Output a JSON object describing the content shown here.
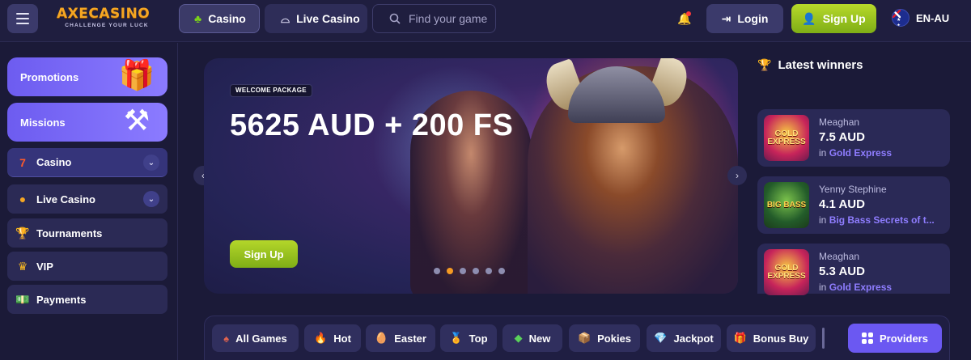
{
  "header": {
    "logo_main": "AXECASINO",
    "logo_sub": "CHALLENGE YOUR LUCK",
    "nav": [
      {
        "label": "Casino",
        "icon": "clover-icon"
      },
      {
        "label": "Live Casino",
        "icon": "cloche-icon"
      }
    ],
    "search_placeholder": "Find your game",
    "login_label": "Login",
    "signup_label": "Sign Up",
    "language": "EN-AU"
  },
  "sidebar": {
    "promo_cards": [
      {
        "label": "Promotions",
        "icon": "gift-icon"
      },
      {
        "label": "Missions",
        "icon": "hammer-icon"
      }
    ],
    "items": [
      {
        "label": "Casino",
        "icon": "seven-icon",
        "expandable": true
      },
      {
        "label": "Live Casino",
        "icon": "chip-icon",
        "expandable": true
      },
      {
        "label": "Tournaments",
        "icon": "trophy-icon",
        "expandable": false
      },
      {
        "label": "VIP",
        "icon": "crown-icon",
        "expandable": false
      },
      {
        "label": "Payments",
        "icon": "cash-icon",
        "expandable": false
      }
    ]
  },
  "hero": {
    "tag": "WELCOME PACKAGE",
    "title": "5625 AUD + 200 FS",
    "cta": "Sign Up",
    "slides": 6,
    "active_slide": 2
  },
  "winners": {
    "title": "Latest winners",
    "prefix": "in",
    "list": [
      {
        "name": "Meaghan",
        "amount": "7.5 AUD",
        "game": "Gold Express",
        "thumb_text": "GOLD EXPRESS"
      },
      {
        "name": "Yenny Stephine",
        "amount": "4.1 AUD",
        "game": "Big Bass Secrets of t...",
        "thumb_text": "BIG BASS"
      },
      {
        "name": "Meaghan",
        "amount": "5.3 AUD",
        "game": "Gold Express",
        "thumb_text": "GOLD EXPRESS"
      }
    ]
  },
  "categories": [
    {
      "label": "All Games",
      "icon": "slot-icon"
    },
    {
      "label": "Hot",
      "icon": "fire-icon"
    },
    {
      "label": "Easter",
      "icon": "egg-icon"
    },
    {
      "label": "Top",
      "icon": "medal-icon"
    },
    {
      "label": "New",
      "icon": "new-icon"
    },
    {
      "label": "Pokies",
      "icon": "box-icon"
    },
    {
      "label": "Jackpot",
      "icon": "diamond-icon"
    },
    {
      "label": "Bonus Buy",
      "icon": "bonus-icon"
    }
  ],
  "providers_label": "Providers",
  "colors": {
    "background": "#1b1a38",
    "accent_purple": "#6b58f2",
    "accent_green": "#9cc620",
    "accent_orange": "#f59a23"
  }
}
